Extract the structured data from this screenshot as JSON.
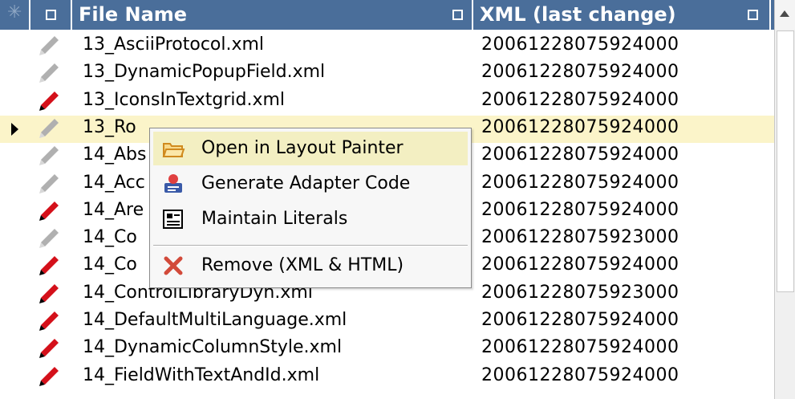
{
  "header": {
    "filename_label": "File Name",
    "xml_label": "XML (last change)"
  },
  "rows": [
    {
      "name": "13_AsciiProtocol.xml",
      "ts": "20061228075924000",
      "icon": "pencil-gray-icon"
    },
    {
      "name": "13_DynamicPopupField.xml",
      "ts": "20061228075924000",
      "icon": "pencil-gray-icon"
    },
    {
      "name": "13_IconsInTextgrid.xml",
      "ts": "20061228075924000",
      "icon": "pencil-red-icon"
    },
    {
      "name": "13_Ro",
      "ts": "20061228075924000",
      "icon": "pencil-gray-icon",
      "selected": true
    },
    {
      "name": "14_Abs",
      "ts": "20061228075924000",
      "icon": "pencil-gray-icon"
    },
    {
      "name": "14_Acc",
      "ts": "20061228075924000",
      "icon": "pencil-gray-icon"
    },
    {
      "name": "14_Are",
      "ts": "20061228075924000",
      "icon": "pencil-red-icon"
    },
    {
      "name": "14_Co",
      "ts": "20061228075923000",
      "icon": "pencil-gray-icon"
    },
    {
      "name": "14_Co",
      "ts": "20061228075924000",
      "icon": "pencil-red-icon"
    },
    {
      "name": "14_ControlLibraryDyn.xml",
      "ts": "20061228075923000",
      "icon": "pencil-red-icon"
    },
    {
      "name": "14_DefaultMultiLanguage.xml",
      "ts": "20061228075924000",
      "icon": "pencil-red-icon"
    },
    {
      "name": "14_DynamicColumnStyle.xml",
      "ts": "20061228075924000",
      "icon": "pencil-red-icon"
    },
    {
      "name": "14_FieldWithTextAndId.xml",
      "ts": "20061228075924000",
      "icon": "pencil-red-icon"
    }
  ],
  "context_menu": {
    "items": [
      {
        "label": "Open in Layout Painter",
        "icon": "folder-open-icon"
      },
      {
        "label": "Generate Adapter Code",
        "icon": "generate-code-icon"
      },
      {
        "label": "Maintain Literals",
        "icon": "literals-icon"
      },
      {
        "label": "Remove (XML & HTML)",
        "icon": "remove-x-icon"
      }
    ]
  },
  "colors": {
    "header_bg": "#4a6e9a",
    "selected_row_bg": "#fbf4c9",
    "menu_highlight": "#f3efc2",
    "pencil_red": "#d4101a",
    "pencil_gray": "#b0b0b0"
  }
}
